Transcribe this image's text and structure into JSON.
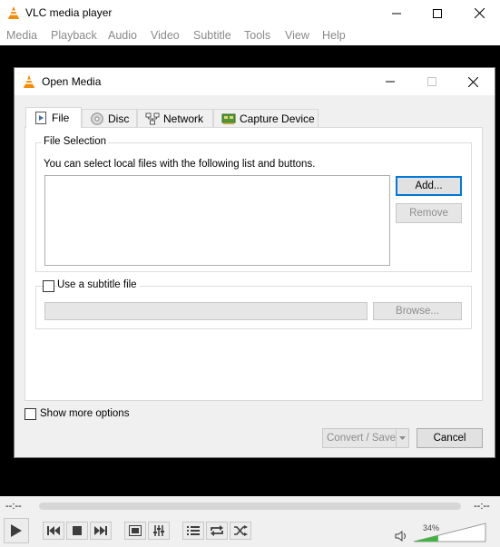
{
  "app": {
    "title": "VLC media player",
    "menu": [
      "Media",
      "Playback",
      "Audio",
      "Video",
      "Subtitle",
      "Tools",
      "View",
      "Help"
    ]
  },
  "dialog": {
    "title": "Open Media",
    "tabs": [
      {
        "label": "File",
        "icon": "file-play-icon"
      },
      {
        "label": "Disc",
        "icon": "disc-icon"
      },
      {
        "label": "Network",
        "icon": "network-icon"
      },
      {
        "label": "Capture Device",
        "icon": "capture-card-icon"
      }
    ],
    "file_selection": {
      "title": "File Selection",
      "description": "You can select local files with the following list and buttons.",
      "add_label": "Add...",
      "remove_label": "Remove"
    },
    "subtitle": {
      "checkbox_label": "Use a subtitle file",
      "browse_label": "Browse..."
    },
    "show_more_label": "Show more options",
    "convert_label": "Convert / Save",
    "cancel_label": "Cancel"
  },
  "player": {
    "time_left": "--:--",
    "time_right": "--:--",
    "volume_label": "34%",
    "volume_level": 0.34
  }
}
